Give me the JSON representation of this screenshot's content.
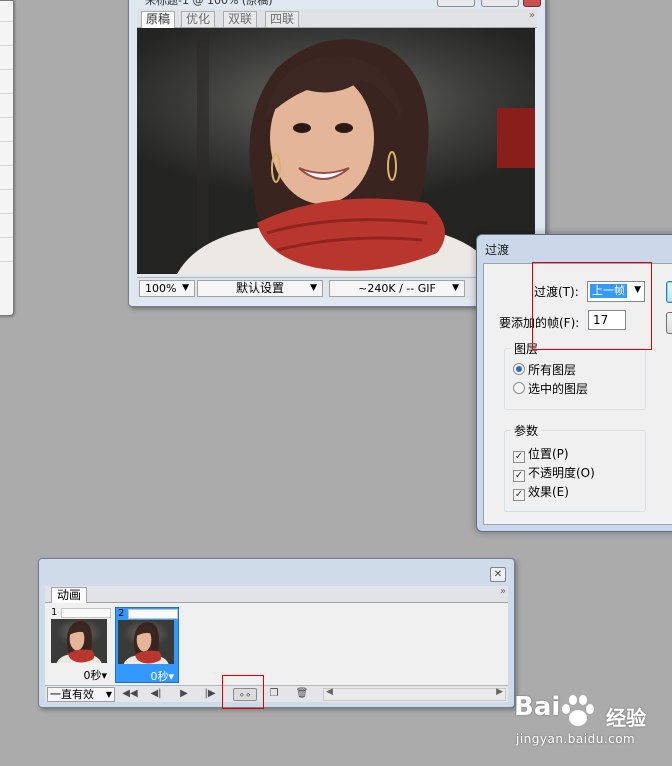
{
  "document": {
    "title": "未标题-1 @ 100% (原稿)",
    "tabs": [
      "原稿",
      "优化",
      "双联",
      "四联"
    ],
    "active_tab": "原稿",
    "status": {
      "zoom": "100%",
      "preset": "默认设置",
      "size_format": "~240K / -- GIF"
    }
  },
  "dialog": {
    "title": "过渡",
    "transition_label": "过渡(T):",
    "transition_value": "上一帧",
    "frames_label": "要添加的帧(F):",
    "frames_value": "17",
    "layers_group": "图层",
    "layers_options": [
      "所有图层",
      "选中的图层"
    ],
    "layers_selected": "所有图层",
    "params_group": "参数",
    "params": [
      "位置(P)",
      "不透明度(O)",
      "效果(E)"
    ]
  },
  "animation": {
    "tab": "动画",
    "frames": [
      {
        "number": "1",
        "delay": "0秒"
      },
      {
        "number": "2",
        "delay": "0秒"
      }
    ],
    "loop": "一直有效"
  },
  "watermark": {
    "brand_left": "Bai",
    "brand_right": "经验",
    "url": "jingyan.baidu.com"
  },
  "colors": {
    "desktop": "#ababab",
    "selection": "#3399ff",
    "highlight_box": "#e00000",
    "scarf": "#b8362e"
  }
}
